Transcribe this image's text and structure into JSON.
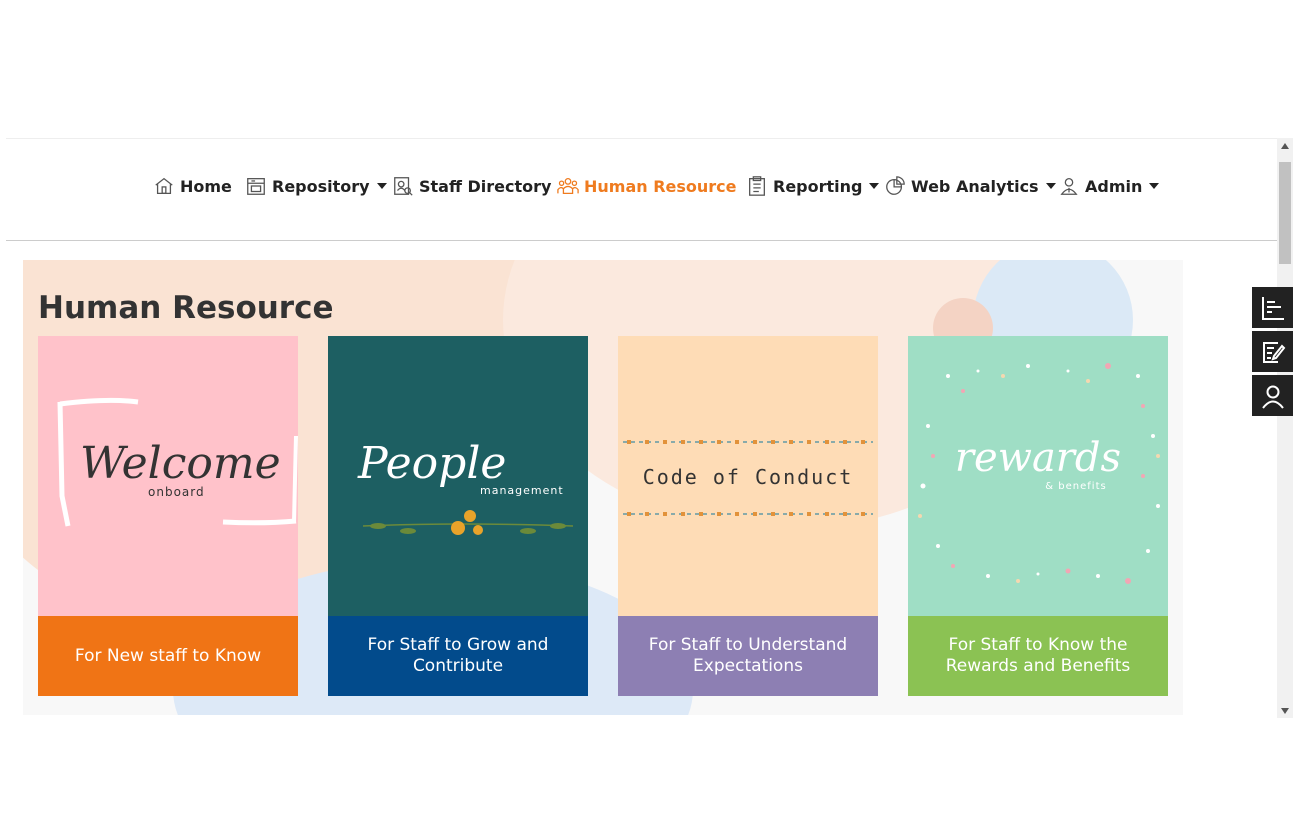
{
  "nav": {
    "items": [
      {
        "label": "Home",
        "icon": "home-icon",
        "dropdown": false
      },
      {
        "label": "Repository",
        "icon": "repository-icon",
        "dropdown": true
      },
      {
        "label": "Staff Directory",
        "icon": "staff-directory-icon",
        "dropdown": false
      },
      {
        "label": "Human Resource",
        "icon": "people-icon",
        "dropdown": false,
        "active": true
      },
      {
        "label": "Reporting",
        "icon": "clipboard-icon",
        "dropdown": true
      },
      {
        "label": "Web Analytics",
        "icon": "pie-chart-icon",
        "dropdown": true
      },
      {
        "label": "Admin",
        "icon": "admin-user-icon",
        "dropdown": true
      }
    ],
    "active_color": "#ef7b1f"
  },
  "page": {
    "title": "Human Resource"
  },
  "cards": [
    {
      "image_text": "Welcome",
      "image_subtext": "onboard",
      "caption": "For New staff to Know",
      "image_bg": "#ffc2ca",
      "caption_bg": "#f07415"
    },
    {
      "image_text": "People",
      "image_subtext": "management",
      "caption": "For Staff to Grow and Contribute",
      "image_bg": "#1d5f62",
      "caption_bg": "#024b8c"
    },
    {
      "image_text": "Code of Conduct",
      "caption": "For Staff to Understand Expectations",
      "image_bg": "#fedcb6",
      "caption_bg": "#8d7fb3"
    },
    {
      "image_text": "rewards",
      "image_subtext": "& benefits",
      "caption": "For Staff to Know the Rewards and Benefits",
      "image_bg": "#9fdec5",
      "caption_bg": "#8bc253"
    }
  ],
  "side_tools": [
    {
      "icon": "bar-list-icon"
    },
    {
      "icon": "edit-note-icon"
    },
    {
      "icon": "user-profile-icon"
    }
  ]
}
